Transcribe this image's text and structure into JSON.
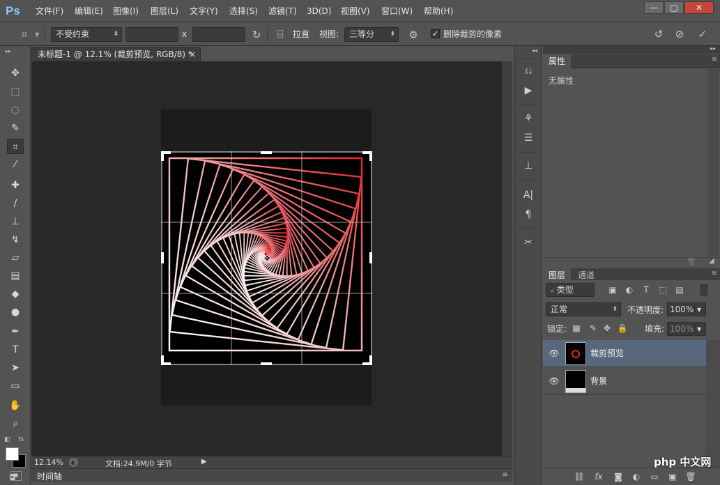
{
  "app": {
    "logo": "Ps"
  },
  "menu": [
    "文件(F)",
    "编辑(E)",
    "图像(I)",
    "图层(L)",
    "文字(Y)",
    "选择(S)",
    "滤镜(T)",
    "3D(D)",
    "视图(V)",
    "窗口(W)",
    "帮助(H)"
  ],
  "window_controls": {
    "minimize": "—",
    "maximize": "▢",
    "close": "✕"
  },
  "options": {
    "ratio_select": "不受约束",
    "x_label": "x",
    "straighten_label": "拉直",
    "view_label": "视图:",
    "view_select": "三等分",
    "delete_pixels_checked": true,
    "delete_pixels_label": "删除裁剪的像素"
  },
  "document": {
    "tab_title": "未标题-1 @ 12.1% (裁剪预览, RGB/8) *",
    "tab_close": "×",
    "zoom": "12.14%",
    "doc_info": "文档:24.9M/0 字节"
  },
  "timeline": {
    "label": "时间轴"
  },
  "properties_panel": {
    "tab": "属性",
    "empty_text": "无属性"
  },
  "layers_panel": {
    "tabs": [
      "图层",
      "通道"
    ],
    "filter_label": "类型",
    "blend_mode": "正常",
    "opacity_label": "不透明度:",
    "opacity_value": "100%",
    "lock_label": "锁定:",
    "fill_label": "填充:",
    "fill_value": "100%",
    "layers": [
      {
        "name": "裁剪预览",
        "selected": true,
        "visible": true
      },
      {
        "name": "背景",
        "selected": false,
        "visible": true
      }
    ]
  },
  "watermark": "php 中文网",
  "colors": {
    "accent": "#58677c",
    "spiral_red": "#e8222a",
    "canvas_bg": "#282828"
  }
}
